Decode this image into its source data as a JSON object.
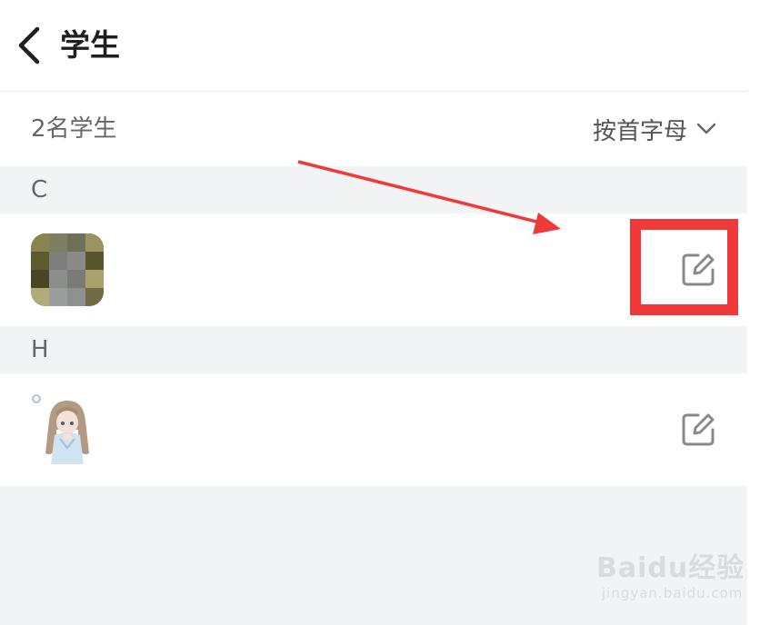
{
  "header": {
    "back_icon": "chevron-left-icon",
    "title": "学生"
  },
  "summary": {
    "count_text": "2名学生",
    "sort_label": "按首字母",
    "sort_icon": "chevron-down-icon"
  },
  "groups": [
    {
      "letter": "C",
      "students": [
        {
          "avatar": "pixelated-photo-avatar",
          "action_icon": "edit-icon"
        }
      ]
    },
    {
      "letter": "H",
      "students": [
        {
          "avatar": "anime-girl-avatar",
          "action_icon": "edit-icon"
        }
      ]
    }
  ],
  "annotation": {
    "color": "#f03a3a",
    "highlight_target": "edit-button"
  },
  "watermark": {
    "brand": "Baidu经验",
    "url": "jingyan.baidu.com"
  },
  "colors": {
    "panel_bg": "#f2f3f5",
    "text_secondary": "#666666",
    "icon_gray": "#8a8a8a"
  }
}
